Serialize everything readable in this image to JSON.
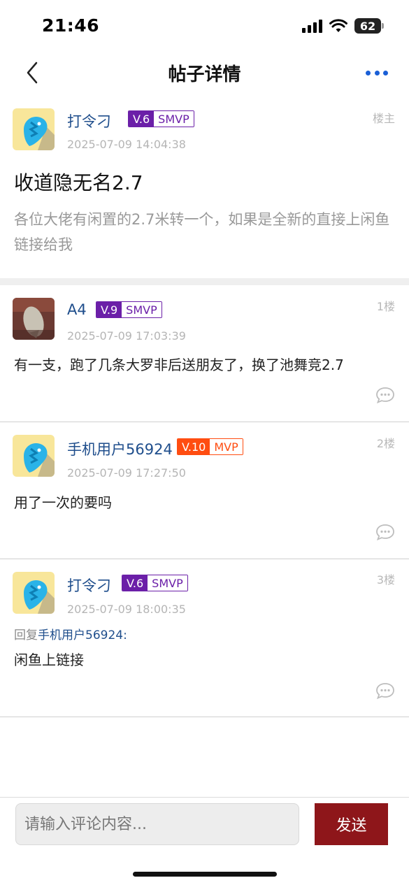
{
  "status_bar": {
    "time": "21:46",
    "battery": "62",
    "icons": [
      "signal-icon",
      "wifi-icon",
      "battery-icon"
    ]
  },
  "nav": {
    "title": "帖子详情",
    "back_icon": "chevron-left-icon",
    "more_icon": "more-dots-icon"
  },
  "post": {
    "author": "打令刁",
    "level": "V.6",
    "tier": "SMVP",
    "time": "2025-07-09 14:04:38",
    "floor": "楼主",
    "title": "收道隐无名2.7",
    "body": "各位大佬有闲置的2.7米转一个，如果是全新的直接上闲鱼链接给我"
  },
  "comments": [
    {
      "author": "A4",
      "level": "V.9",
      "tier": "SMVP",
      "time": "2025-07-09 17:03:39",
      "floor": "1楼",
      "text": "有一支，跑了几条大罗非后送朋友了，换了池舞竞2.7"
    },
    {
      "author": "手机用户56924",
      "level": "V.10",
      "tier": "MVP",
      "time": "2025-07-09 17:27:50",
      "floor": "2楼",
      "text": "用了一次的要吗"
    },
    {
      "author": "打令刁",
      "level": "V.6",
      "tier": "SMVP",
      "time": "2025-07-09 18:00:35",
      "floor": "3楼",
      "reply_prefix": "回复",
      "reply_target": "手机用户56924:",
      "text": "闲鱼上链接"
    }
  ],
  "input": {
    "placeholder": "请输入评论内容..."
  },
  "send_label": "发送",
  "colors": {
    "accent_blue": "#1f4e8c",
    "badge_purple": "#6b1fa8",
    "badge_orange": "#ff4d11",
    "send_button": "#8e161a",
    "more_dots": "#1a5fd6"
  }
}
